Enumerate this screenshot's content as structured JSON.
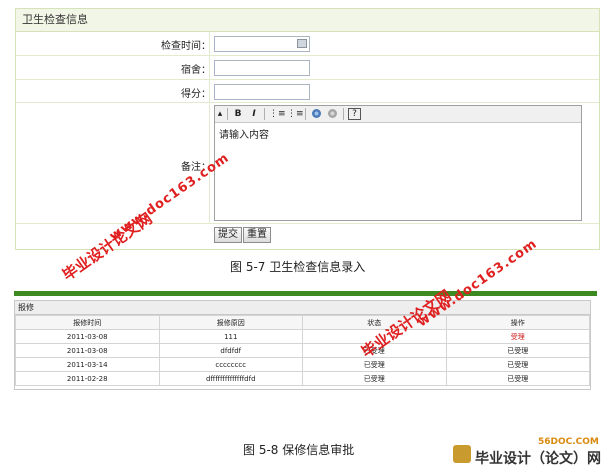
{
  "form": {
    "title": "卫生检查信息",
    "fields": [
      {
        "label": "检查时间：",
        "value": ""
      },
      {
        "label": "宿舍：",
        "value": ""
      },
      {
        "label": "得分：",
        "value": ""
      },
      {
        "label": "备注：",
        "value": "请输入内容"
      }
    ],
    "editor_toolbar": [
      "B",
      "I",
      "⋮≡",
      "⋮≡",
      "?"
    ],
    "buttons": {
      "submit": "提交",
      "reset": "重置"
    }
  },
  "captions": {
    "fig7": "图 5-7  卫生检查信息录入",
    "fig8": "图 5-8 保修信息审批"
  },
  "repair_table": {
    "title": "报修",
    "headers": [
      "报修时间",
      "报修原因",
      "状态",
      "操作"
    ],
    "rows": [
      [
        "2011-03-08",
        "111",
        "",
        "受理"
      ],
      [
        "2011-03-08",
        "dfdfdf",
        "已受理",
        "已受理"
      ],
      [
        "2011-03-14",
        "cccccccc",
        "已受理",
        "已受理"
      ],
      [
        "2011-02-28",
        "dffffffffffffffdfd",
        "已受理",
        "已受理"
      ]
    ]
  },
  "watermarks": {
    "name": "毕业设计论文网",
    "url": "www.doc163.com"
  },
  "logo": {
    "site": "56DOC.COM",
    "name": "毕业设计（论文）网"
  },
  "colors": {
    "accent_green": "#3d8a22",
    "watermark_red": "#e02020"
  }
}
